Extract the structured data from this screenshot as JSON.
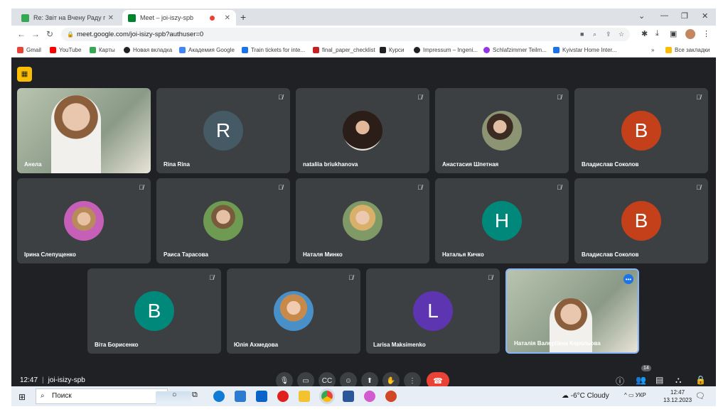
{
  "browser": {
    "tabs": [
      {
        "title": "Re: Звіт на Вчену Раду по ДО -",
        "active": false,
        "favicon_color": "#34a853"
      },
      {
        "title": "Meet – joi-iszy-spb",
        "active": true,
        "favicon_color": "#00832d",
        "recording": true
      }
    ],
    "url": "meet.google.com/joi-isizy-spb?authuser=0",
    "bookmarks": [
      {
        "label": "Gmail",
        "color": "#ea4335"
      },
      {
        "label": "YouTube",
        "color": "#ff0000"
      },
      {
        "label": "Карты",
        "color": "#34a853"
      },
      {
        "label": "Новая вкладка",
        "color": "#202124"
      },
      {
        "label": "Академия Google",
        "color": "#4285f4"
      },
      {
        "label": "Train tickets for inte...",
        "color": "#1a73e8"
      },
      {
        "label": "final_paper_checklist",
        "color": "#c5221f"
      },
      {
        "label": "Курси",
        "color": "#202124"
      },
      {
        "label": "Impressum – Ingeni...",
        "color": "#202124"
      },
      {
        "label": "Schlafzimmer Teilm...",
        "color": "#9334e6"
      },
      {
        "label": "Kyivstar Home Inter...",
        "color": "#1a73e8"
      }
    ],
    "all_bookmarks": "Все закладки"
  },
  "participants": [
    {
      "name": "Анела",
      "type": "video",
      "muted": false
    },
    {
      "name": "Rina Rina",
      "type": "letter",
      "letter": "R",
      "color": "#455a64",
      "muted": true
    },
    {
      "name": "nataliia briukhanova",
      "type": "photo",
      "muted": true
    },
    {
      "name": "Анастасия Шпетная",
      "type": "photo",
      "muted": true
    },
    {
      "name": "Владислав Соколов",
      "type": "letter",
      "letter": "В",
      "color": "#c3401a",
      "muted": true
    },
    {
      "name": "Ірина Слепущенко",
      "type": "photo",
      "muted": true
    },
    {
      "name": "Раиса Тарасова",
      "type": "photo",
      "muted": true
    },
    {
      "name": "Наталя Минко",
      "type": "photo",
      "muted": true
    },
    {
      "name": "Наталья Кичко",
      "type": "letter",
      "letter": "Н",
      "color": "#00897b",
      "muted": true
    },
    {
      "name": "Владислав Соколов",
      "type": "letter",
      "letter": "В",
      "color": "#c3401a",
      "muted": true
    },
    {
      "name": "Віта Борисенко",
      "type": "letter",
      "letter": "В",
      "color": "#00897b",
      "muted": true
    },
    {
      "name": "Юлія Ахмедова",
      "type": "photo",
      "muted": true
    },
    {
      "name": "Larisa Maksimenko",
      "type": "letter",
      "letter": "L",
      "color": "#5e35b1",
      "muted": true
    },
    {
      "name": "Наталія Валеріївна Корольова",
      "type": "video",
      "muted": false,
      "self": true
    }
  ],
  "meeting": {
    "time": "12:47",
    "code": "joi-isizy-spb",
    "people_count": "14"
  },
  "taskbar": {
    "search_placeholder": "Поиск",
    "weather": "-6°C Cloudy",
    "language": "УКР",
    "time": "12:47",
    "date": "13.12.2023"
  }
}
